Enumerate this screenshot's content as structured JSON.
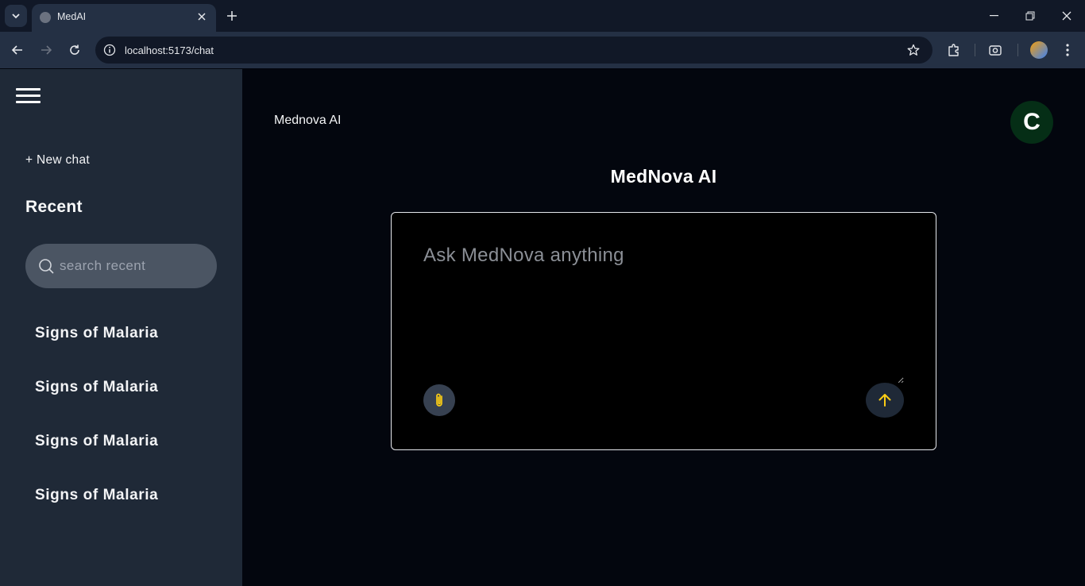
{
  "browser": {
    "tab_title": "MedAI",
    "url": "localhost:5173/chat"
  },
  "sidebar": {
    "new_chat_label": "+ New chat",
    "recent_heading": "Recent",
    "search_placeholder": "search recent",
    "recent_items": [
      {
        "label": "Signs of Malaria"
      },
      {
        "label": "Signs of Malaria"
      },
      {
        "label": "Signs of Malaria"
      },
      {
        "label": "Signs of Malaria"
      }
    ]
  },
  "header": {
    "brand": "Mednova AI",
    "avatar_initial": "C"
  },
  "main": {
    "title": "MedNova AI",
    "prompt_placeholder": "Ask MedNova anything"
  },
  "colors": {
    "accent_icon": "#facc15",
    "sidebar_bg": "#1f2937",
    "main_bg": "#03060e",
    "avatar_bg": "#052e16"
  }
}
